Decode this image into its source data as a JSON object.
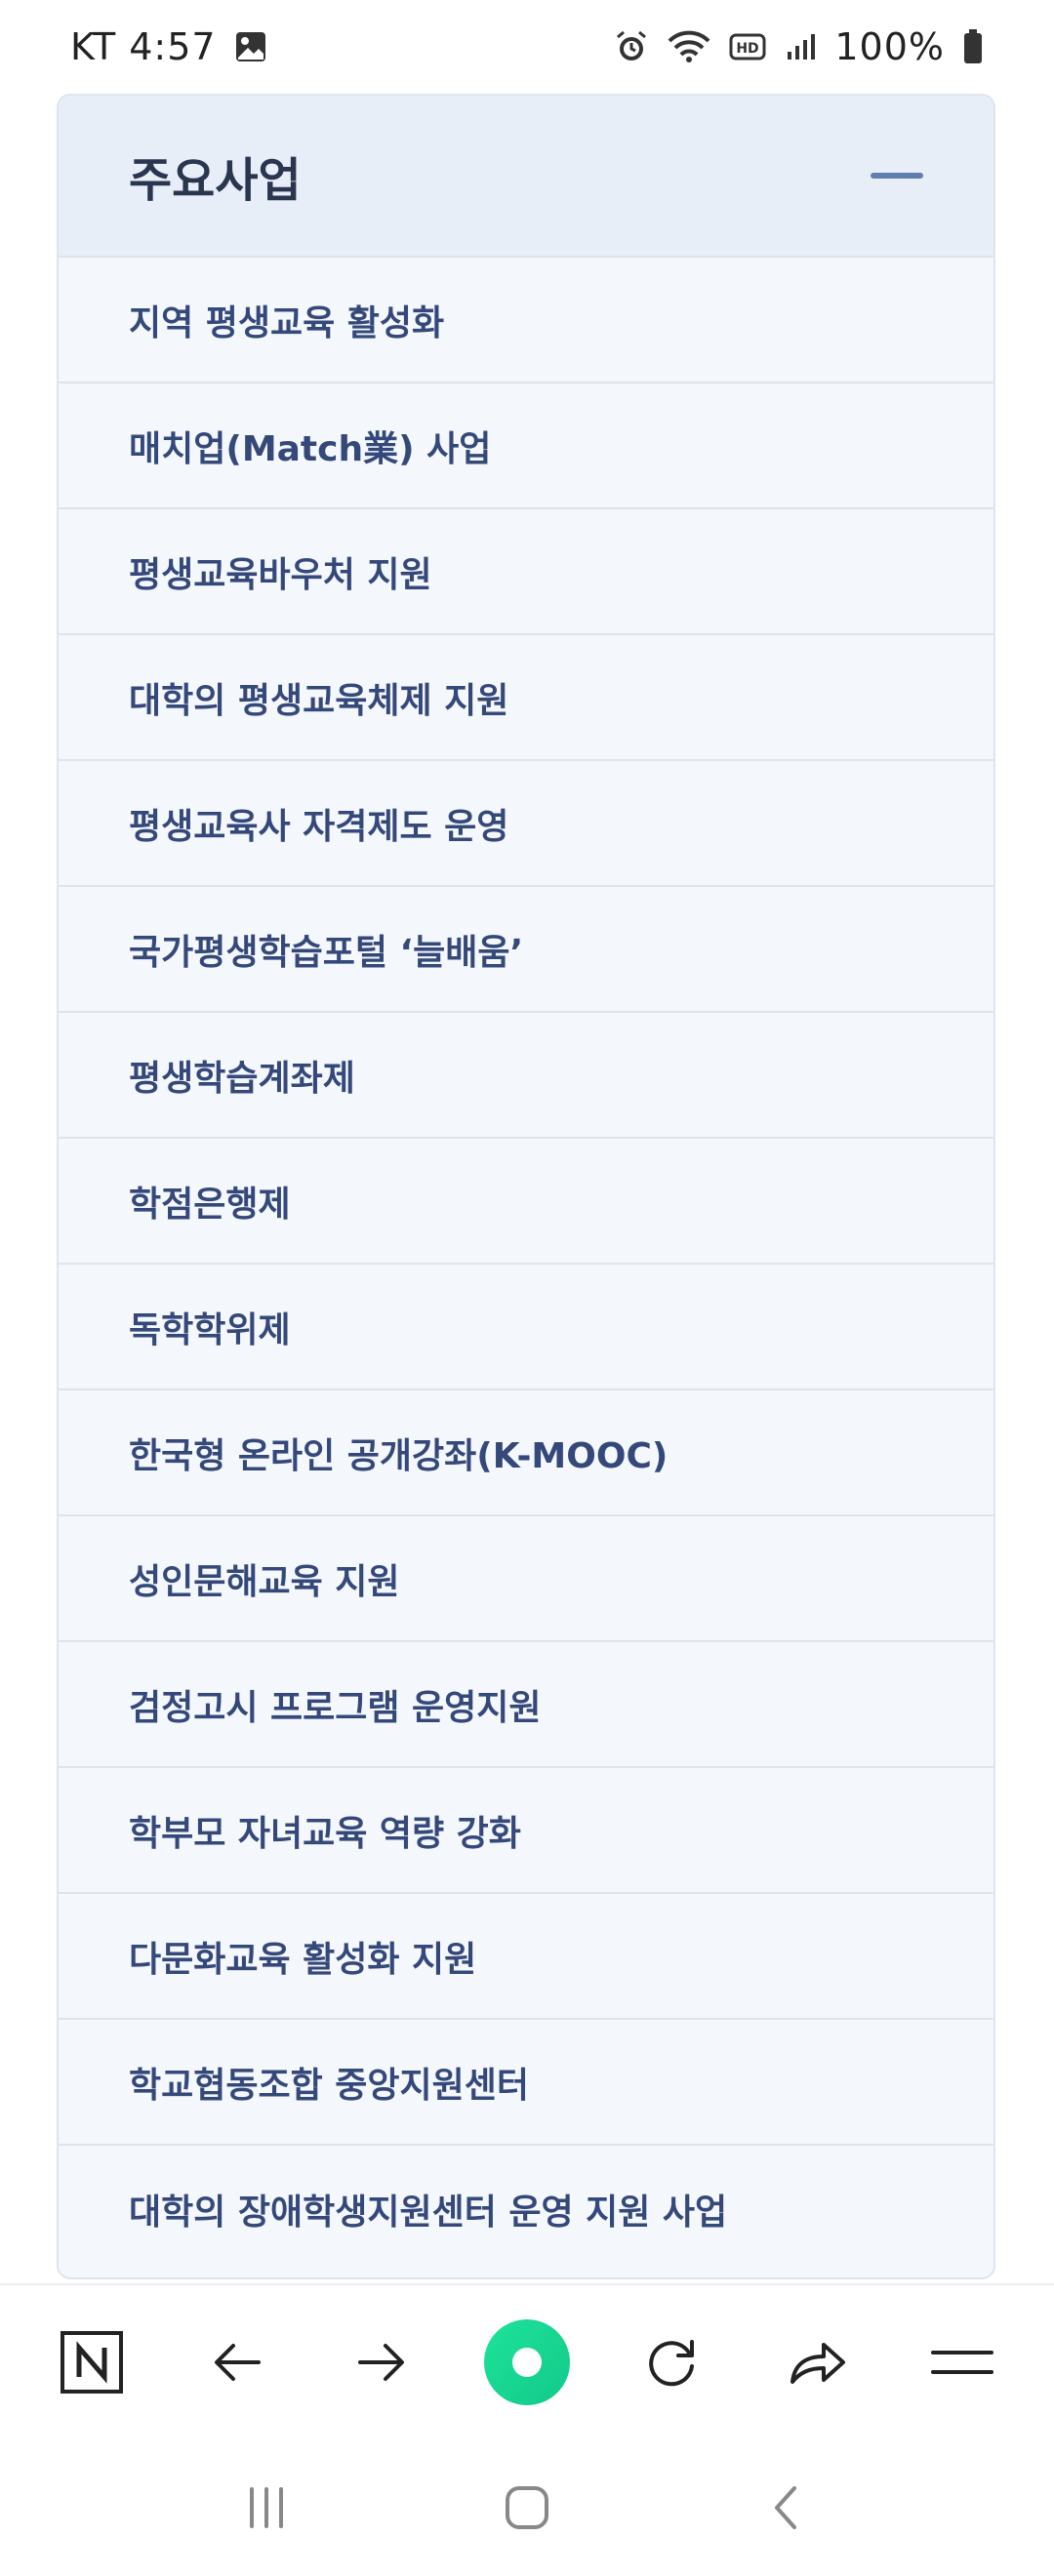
{
  "status_bar": {
    "carrier_time": "KT 4:57",
    "battery": "100%",
    "icons": [
      "image-icon",
      "alarm-icon",
      "wifi-icon",
      "hd-icon",
      "signal-icon",
      "battery-icon"
    ]
  },
  "panel": {
    "title": "주요사업",
    "items": [
      {
        "label": "지역 평생교육 활성화"
      },
      {
        "label": "매치업(Match業) 사업"
      },
      {
        "label": "평생교육바우처 지원"
      },
      {
        "label": "대학의 평생교육체제 지원"
      },
      {
        "label": "평생교육사 자격제도 운영"
      },
      {
        "label": "국가평생학습포털 ‘늘배움’"
      },
      {
        "label": "평생학습계좌제"
      },
      {
        "label": "학점은행제"
      },
      {
        "label": "독학학위제"
      },
      {
        "label": "한국형 온라인 공개강좌(K-MOOC)"
      },
      {
        "label": "성인문해교육 지원"
      },
      {
        "label": "검정고시 프로그램 운영지원"
      },
      {
        "label": "학부모 자녀교육 역량 강화"
      },
      {
        "label": "다문화교육 활성화 지원"
      },
      {
        "label": "학교협동조합 중앙지원센터"
      },
      {
        "label": "대학의 장애학생지원센터 운영 지원 사업"
      }
    ]
  },
  "toolbar": {
    "icons": [
      "naver-n-icon",
      "back-arrow-icon",
      "forward-arrow-icon",
      "home-green-icon",
      "refresh-icon",
      "share-icon",
      "menu-icon"
    ]
  },
  "nav_bar": {
    "icons": [
      "recent-apps-icon",
      "home-icon",
      "back-icon"
    ]
  },
  "colors": {
    "accent_green": "#12c98a",
    "item_text": "#34487a",
    "header_bg": "#e8eef8"
  }
}
